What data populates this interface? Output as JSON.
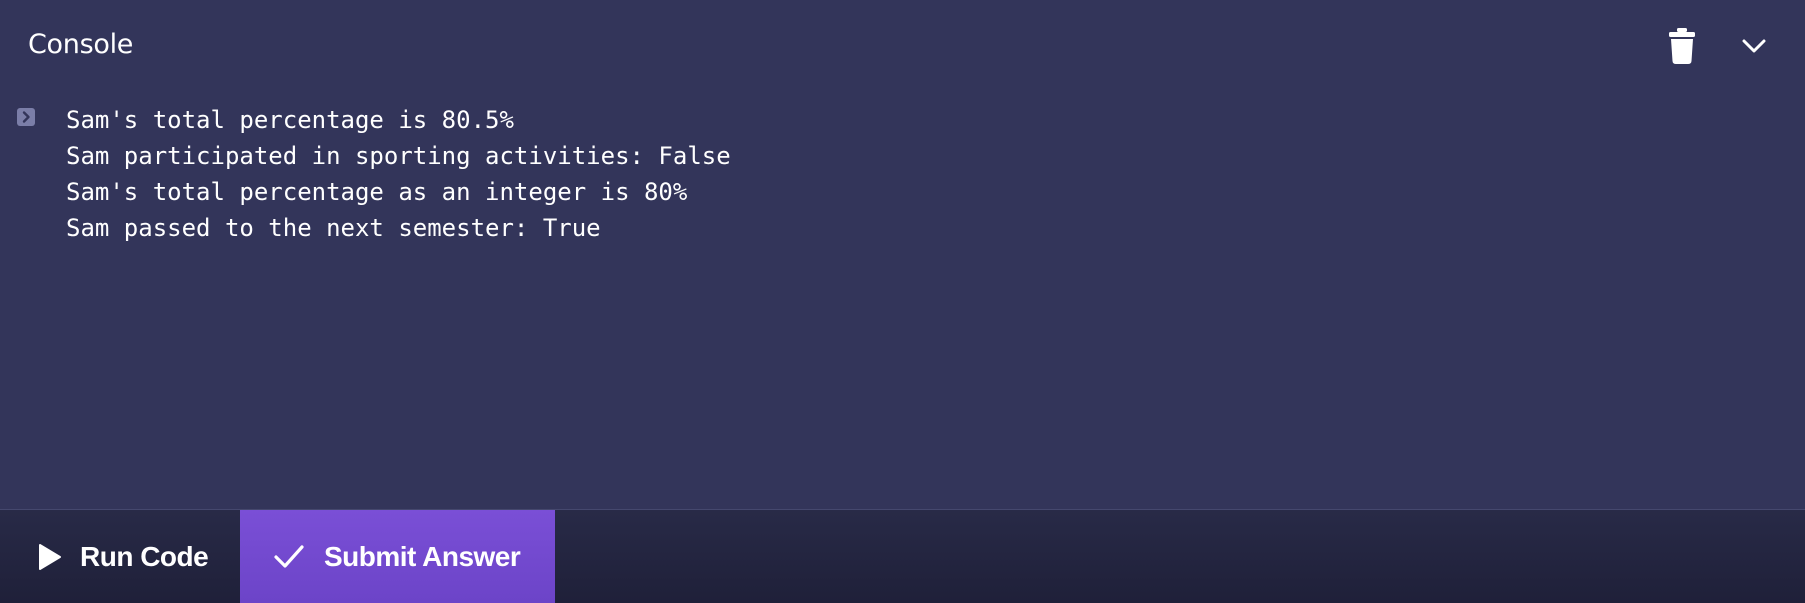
{
  "console": {
    "title": "Console",
    "actions": {
      "clear_icon": "trash-icon",
      "collapse_icon": "chevron-down-icon"
    },
    "prompt_icon": "chevron-right-icon",
    "output_lines": [
      "Sam's total percentage is 80.5%",
      "Sam participated in sporting activities: False",
      "Sam's total percentage as an integer is 80%",
      "Sam passed to the next semester: True"
    ]
  },
  "footer": {
    "run_button": {
      "label": "Run Code",
      "icon": "play-icon"
    },
    "submit_button": {
      "label": "Submit Answer",
      "icon": "check-icon"
    }
  },
  "colors": {
    "background": "#33355a",
    "footer_background": "#23243f",
    "submit_accent": "#7349d0",
    "text": "#ffffff",
    "muted_icon": "#7b7ea8"
  }
}
